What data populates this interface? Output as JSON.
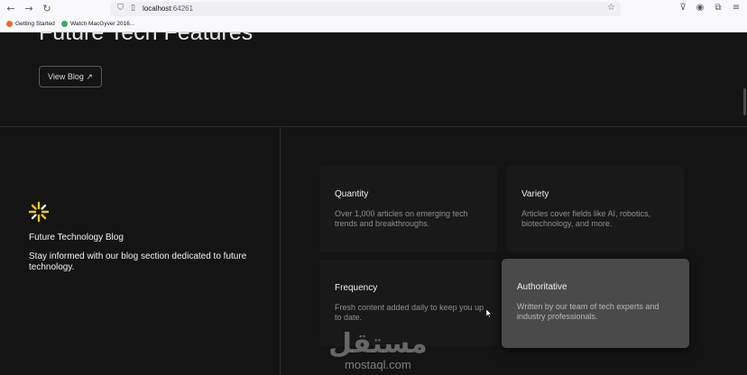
{
  "browser": {
    "url_host": "localhost",
    "url_port": ":64261",
    "bookmarks": [
      {
        "label": "Getting Started",
        "color": "#e66a2c"
      },
      {
        "label": "Watch MacGyver 2016...",
        "color": "#3ea66b"
      }
    ]
  },
  "hero": {
    "title": "Future Tech Features",
    "button_label": "View Blog ↗"
  },
  "intro": {
    "title": "Future Technology Blog",
    "description": "Stay informed with our blog section dedicated to future technology."
  },
  "cards": [
    {
      "title": "Quantity",
      "description": "Over 1,000 articles on emerging tech trends and breakthroughs."
    },
    {
      "title": "Variety",
      "description": "Articles cover fields like AI, robotics, biotechnology, and more."
    },
    {
      "title": "Frequency",
      "description": "Fresh content added daily to keep you up to date."
    },
    {
      "title": "Authoritative",
      "description": "Written by our team of tech experts and industry professionals."
    }
  ],
  "watermark": {
    "arabic": "مستقل",
    "latin": "mostaql.com"
  },
  "colors": {
    "accent": "#f5c518",
    "page_bg": "#141414",
    "card_bg": "#191919",
    "card_active_bg": "#4a4a4a"
  }
}
